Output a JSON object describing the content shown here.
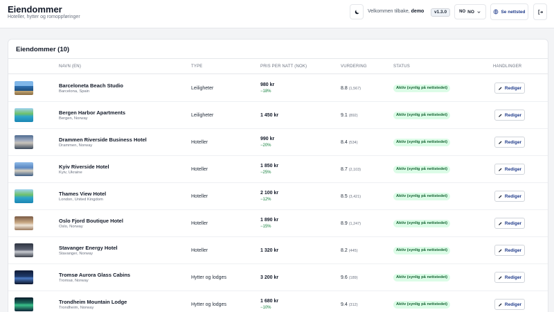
{
  "header": {
    "title": "Eiendommer",
    "subtitle": "Hoteller, hytter og romoppføringer",
    "welcome_prefix": "Velkommen tilbake,",
    "username": "demo",
    "version": "v1.3.0",
    "lang_code": "NO",
    "lang_selected": "NO",
    "site_label": "Se nettsted",
    "icons": {
      "theme": "moon-icon",
      "lang": "chevron-down-icon",
      "site": "globe-icon",
      "logout": "logout-icon"
    }
  },
  "properties": {
    "title": "Eiendommer (10)",
    "columns": {
      "name": "NAVN (EN)",
      "type": "TYPE",
      "price": "PRIS PER NATT (NOK)",
      "rating": "VURDERING",
      "status": "STATUS",
      "actions": "HANDLINGER"
    },
    "edit_label": "Rediger",
    "rows": [
      {
        "name": "Barceloneta Beach Studio",
        "location": "Barcelona, Spain",
        "type": "Leiligheter",
        "price": "980 kr",
        "discount": "−18%",
        "rating": "8.8",
        "reviews": "(1,567)",
        "status": "Aktiv (synlig på nettstedet)"
      },
      {
        "name": "Bergen Harbor Apartments",
        "location": "Bergen, Norway",
        "type": "Leiligheter",
        "price": "1 450 kr",
        "discount": "",
        "rating": "9.1",
        "reviews": "(892)",
        "status": "Aktiv (synlig på nettstedet)"
      },
      {
        "name": "Drammen Riverside Business Hotel",
        "location": "Drammen, Norway",
        "type": "Hoteller",
        "price": "990 kr",
        "discount": "−20%",
        "rating": "8.4",
        "reviews": "(534)",
        "status": "Aktiv (synlig på nettstedet)"
      },
      {
        "name": "Kyiv Riverside Hotel",
        "location": "Kyiv, Ukraine",
        "type": "Hoteller",
        "price": "1 850 kr",
        "discount": "−25%",
        "rating": "8.7",
        "reviews": "(2,103)",
        "status": "Aktiv (synlig på nettstedet)"
      },
      {
        "name": "Thames View Hotel",
        "location": "London, United Kingdom",
        "type": "Hoteller",
        "price": "2 100 kr",
        "discount": "−12%",
        "rating": "8.5",
        "reviews": "(3,421)",
        "status": "Aktiv (synlig på nettstedet)"
      },
      {
        "name": "Oslo Fjord Boutique Hotel",
        "location": "Oslo, Norway",
        "type": "Hoteller",
        "price": "1 890 kr",
        "discount": "−15%",
        "rating": "8.9",
        "reviews": "(1,247)",
        "status": "Aktiv (synlig på nettstedet)"
      },
      {
        "name": "Stavanger Energy Hotel",
        "location": "Stavanger, Norway",
        "type": "Hoteller",
        "price": "1 320 kr",
        "discount": "",
        "rating": "8.2",
        "reviews": "(445)",
        "status": "Aktiv (synlig på nettstedet)"
      },
      {
        "name": "Tromsø Aurora Glass Cabins",
        "location": "Tromsø, Norway",
        "type": "Hytter og lodges",
        "price": "3 200 kr",
        "discount": "",
        "rating": "9.6",
        "reviews": "(189)",
        "status": "Aktiv (synlig på nettstedet)"
      },
      {
        "name": "Trondheim Mountain Lodge",
        "location": "Trondheim, Norway",
        "type": "Hytter og lodges",
        "price": "1 680 kr",
        "discount": "−10%",
        "rating": "9.4",
        "reviews": "(312)",
        "status": "Aktiv (synlig på nettstedet)"
      }
    ]
  },
  "colors": {
    "status_bg": "#dcfce7",
    "status_text": "#166534",
    "discount": "#15803d",
    "accent": "#1e3a8a"
  }
}
